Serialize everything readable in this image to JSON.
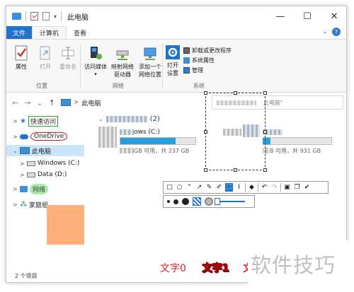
{
  "window": {
    "title": "此电脑",
    "minimize": "—",
    "maximize": "☐",
    "close": "✕"
  },
  "ribbon_tabs": {
    "file": "文件",
    "computer": "计算机",
    "view": "查看"
  },
  "ribbon": {
    "location_group": {
      "label": "位置",
      "properties": "属性",
      "open": "打开",
      "rename": "重命名"
    },
    "network_group": {
      "label": "网络",
      "access_media": "访问媒体",
      "map_drive_1": "映射网络",
      "map_drive_2": "驱动器",
      "add_location_1": "添加一个",
      "add_location_2": "网络位置"
    },
    "system_group": {
      "label": "系统",
      "open_settings_1": "打开",
      "open_settings_2": "设置",
      "uninstall": "卸载或更改程序",
      "system_properties": "系统属性",
      "manage": "管理"
    }
  },
  "address": {
    "back": "←",
    "forward": "→",
    "recent": "⌄",
    "up": "↑",
    "path": "此电脑",
    "chevron": ">",
    "search_placeholder": "此电脑\""
  },
  "sidebar": {
    "quick_access": "快速访问",
    "onedrive": "OneDrive",
    "this_pc": "此电脑",
    "windows_c": "Windows (C:)",
    "data_d": "Data (D:)",
    "network": "网络",
    "homegroup": "家庭组"
  },
  "main": {
    "section_count": "(2)",
    "drive_c_name": "ows (C:)",
    "drive_c_free": "GB 可用，共 237 GB",
    "drive_c_fill": 0.74,
    "drive_d_free": "B 可用，共 931 GB",
    "drive_d_fill": 0.12
  },
  "status": {
    "items": "2 个项目"
  },
  "annotations": {
    "text0": "文字0",
    "text1": "文字1",
    "text2": "文"
  },
  "watermark": "软件技巧"
}
